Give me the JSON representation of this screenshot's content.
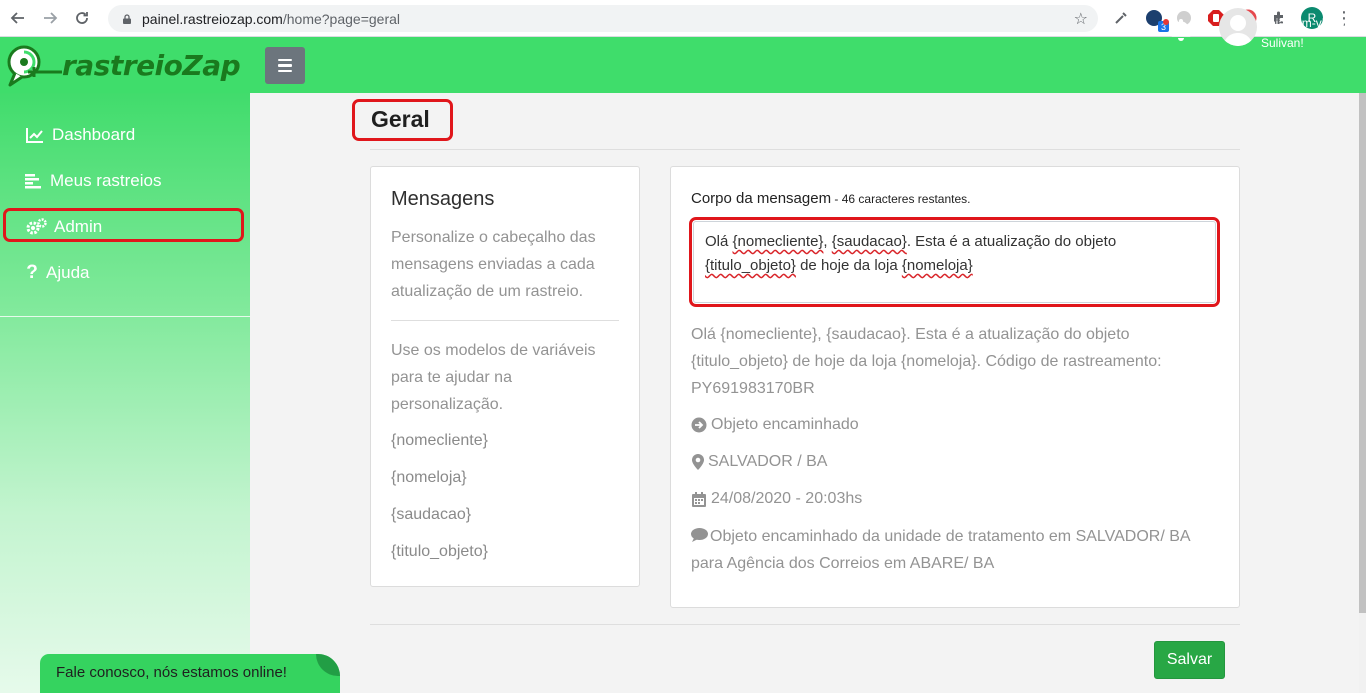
{
  "browser": {
    "url_host": "painel.rastreiozap.com",
    "url_path": "/home?page=geral",
    "extension_badge": "3",
    "profile_initial": "R"
  },
  "header": {
    "logo_text": "rastreioZap",
    "welcome": "Seja bem-vindo, Sulivan!"
  },
  "sidebar": {
    "items": [
      {
        "label": "Dashboard",
        "icon": "chart-line-icon"
      },
      {
        "label": "Meus rastreios",
        "icon": "list-icon"
      },
      {
        "label": "Admin",
        "icon": "gears-icon"
      },
      {
        "label": "Ajuda",
        "icon": "question-icon"
      }
    ]
  },
  "page": {
    "title": "Geral"
  },
  "mensagens": {
    "title": "Mensagens",
    "description": "Personalize o cabeçalho das mensagens enviadas a cada atualização de um rastreio.",
    "help": "Use os modelos de variáveis para te ajudar na personalização.",
    "variables": [
      "{nomecliente}",
      "{nomeloja}",
      "{saudacao}",
      "{titulo_objeto}"
    ]
  },
  "corpo": {
    "label": "Corpo da mensagem",
    "remaining": " - 46 caracteres restantes.",
    "textarea_parts": [
      "Olá ",
      "{nomecliente}",
      ", ",
      "{saudacao}",
      ". Esta é a atualização do objeto ",
      "{titulo_objeto}",
      " de hoje da loja ",
      "{nomeloja}"
    ],
    "preview": "Olá {nomecliente}, {saudacao}. Esta é a atualização do objeto {titulo_objeto} de hoje da loja {nomeloja}. Código de rastreamento: PY691983170BR",
    "status": "Objeto encaminhado",
    "location": "SALVADOR / BA",
    "datetime": "24/08/2020 - 20:03hs",
    "detail": "Objeto encaminhado da unidade de tratamento em SALVADOR/ BA para Agência dos Correios em ABARE/ BA"
  },
  "actions": {
    "save": "Salvar"
  },
  "chat": {
    "text": "Fale conosco, nós estamos online!"
  },
  "colors": {
    "brand_green": "#3fdd6b",
    "logo_green": "#1a7a1e",
    "save_green": "#28a745",
    "highlight_red": "#e0161b"
  }
}
